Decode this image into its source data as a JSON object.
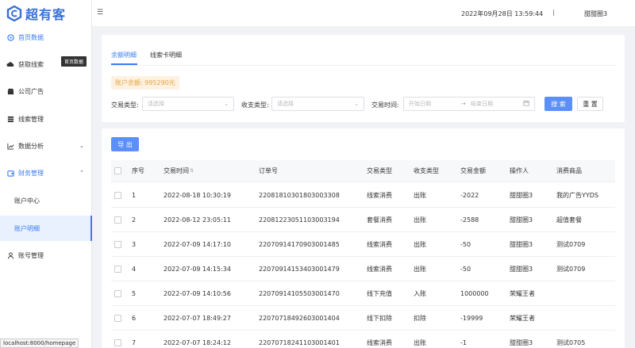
{
  "brand": {
    "name": "超有客"
  },
  "header": {
    "datetime": "2022年09月28日 13:59:44",
    "separator": "|",
    "user": "甜甜圈3"
  },
  "tooltip": "首页数据",
  "url": "localhost:8000/homepage",
  "sidebar": {
    "items": [
      {
        "label": "首页数据",
        "icon": "dashboard-icon"
      },
      {
        "label": "获取线索",
        "icon": "cloud-icon"
      },
      {
        "label": "公司广告",
        "icon": "shop-icon"
      },
      {
        "label": "线索管理",
        "icon": "list-icon"
      },
      {
        "label": "数据分析",
        "icon": "chart-icon"
      },
      {
        "label": "财务管理",
        "icon": "wallet-icon"
      },
      {
        "label": "账号管理",
        "icon": "user-icon"
      }
    ],
    "sub_items": [
      {
        "label": "账户中心"
      },
      {
        "label": "账户明细"
      }
    ]
  },
  "tabs": [
    {
      "label": "余额明细"
    },
    {
      "label": "线索卡明细"
    }
  ],
  "balance_label": "账户余额: 995290元",
  "filters": {
    "trade_type_label": "交易类型:",
    "trade_type_placeholder": "请选择",
    "io_type_label": "收支类型:",
    "io_type_placeholder": "请选择",
    "trade_time_label": "交易时间:",
    "start_placeholder": "开始日期",
    "arrow": "→",
    "end_placeholder": "结束日期",
    "search_label": "搜 索",
    "reset_label": "重 置"
  },
  "export_label": "导 出",
  "table": {
    "columns": [
      "序号",
      "交易时间",
      "订单号",
      "交易类型",
      "收支类型",
      "交易金额",
      "操作人",
      "消费商品"
    ],
    "rows": [
      [
        "1",
        "2022-08-18 10:30:19",
        "22081810301803003308",
        "线索消费",
        "出账",
        "-2022",
        "甜甜圈3",
        "我的广告YYDS"
      ],
      [
        "2",
        "2022-08-12 23:05:11",
        "22081223051103003194",
        "套餐消费",
        "出账",
        "-2588",
        "甜甜圈3",
        "超值套餐"
      ],
      [
        "3",
        "2022-07-09 14:17:10",
        "22070914170903001485",
        "线索消费",
        "出账",
        "-50",
        "甜甜圈3",
        "测试0709"
      ],
      [
        "4",
        "2022-07-09 14:15:34",
        "22070914153403001479",
        "线索消费",
        "出账",
        "-50",
        "甜甜圈3",
        "测试0709"
      ],
      [
        "5",
        "2022-07-09 14:10:56",
        "22070914105503001470",
        "线下充值",
        "入账",
        "1000000",
        "荣耀王者",
        ""
      ],
      [
        "6",
        "2022-07-07 18:49:27",
        "22070718492603001404",
        "线下扣除",
        "扣除",
        "-19999",
        "荣耀王者",
        ""
      ],
      [
        "7",
        "2022-07-07 18:24:12",
        "22070718241103001401",
        "线索消费",
        "出账",
        "-1",
        "甜甜圈3",
        "测试0705"
      ]
    ]
  }
}
